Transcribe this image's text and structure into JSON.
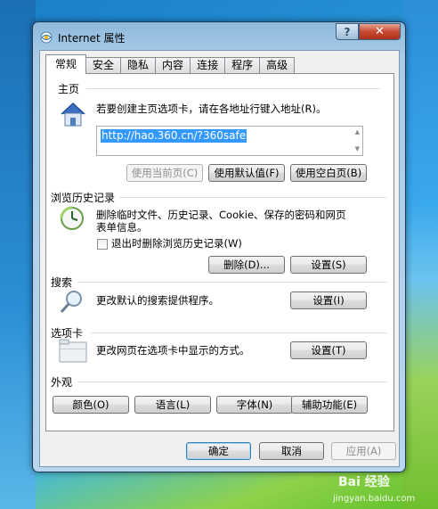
{
  "window": {
    "title": "Internet 属性",
    "help_symbol": "?",
    "close_symbol": "✕"
  },
  "tabs": [
    "常规",
    "安全",
    "隐私",
    "内容",
    "连接",
    "程序",
    "高级"
  ],
  "home": {
    "label": "主页",
    "description": "若要创建主页选项卡，请在各地址行键入地址(R)。",
    "url": "http://hao.360.cn/?360safe",
    "buttons": {
      "current": "使用当前页(C)",
      "default": "使用默认值(F)",
      "blank": "使用空白页(B)"
    }
  },
  "history": {
    "label": "浏览历史记录",
    "description_line1": "删除临时文件、历史记录、Cookie、保存的密码和网页",
    "description_line2": "表单信息。",
    "checkbox_label": "退出时删除浏览历史记录(W)",
    "buttons": {
      "delete": "删除(D)...",
      "settings": "设置(S)"
    }
  },
  "search": {
    "label": "搜索",
    "description": "更改默认的搜索提供程序。",
    "settings_button": "设置(I)"
  },
  "tabs_section": {
    "label": "选项卡",
    "description": "更改网页在选项卡中显示的方式。",
    "settings_button": "设置(T)"
  },
  "appearance": {
    "label": "外观",
    "buttons": {
      "colors": "颜色(O)",
      "languages": "语言(L)",
      "fonts": "字体(N)",
      "accessibility": "辅助功能(E)"
    }
  },
  "footer": {
    "ok": "确定",
    "cancel": "取消",
    "apply": "应用(A)"
  },
  "watermark": {
    "big": "Bai 经验",
    "small": "jingyan.baidu.com"
  },
  "colors": {
    "selection": "#3399ff",
    "client_bg": "#f0f0f0",
    "close_button": "#c74a30"
  },
  "icons": {
    "title": "ie-globe-icon",
    "home": "house-icon",
    "history": "clock-icon",
    "search": "magnifier-icon",
    "tabs": "tabbed-window-icon"
  }
}
